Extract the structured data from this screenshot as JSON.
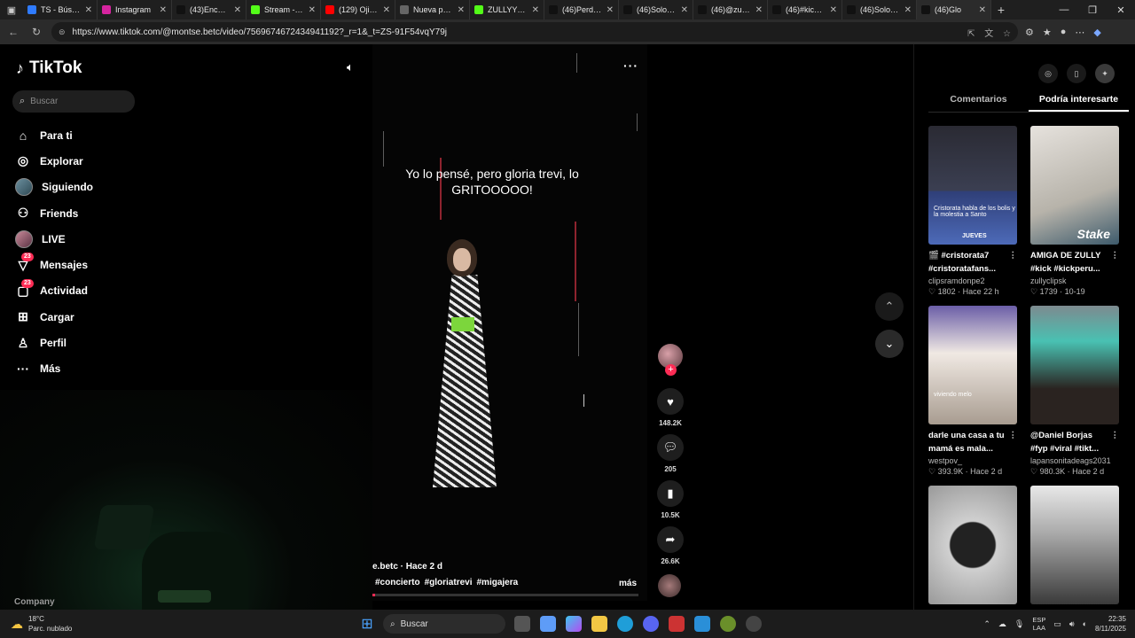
{
  "browser": {
    "tabs": [
      {
        "title": "TS - Búsqueda",
        "color": "#2f7bff"
      },
      {
        "title": "Instagram",
        "color": "#d6249f"
      },
      {
        "title": "(43)Encuentra",
        "color": "#111111"
      },
      {
        "title": "Stream - Kick",
        "color": "#53fc18"
      },
      {
        "title": "(129) Ojitos",
        "color": "#ff0000"
      },
      {
        "title": "Nueva pestaña",
        "color": "#666666"
      },
      {
        "title": "ZULLYY_CS",
        "color": "#53fc18"
      },
      {
        "title": "(46)Perdóname",
        "color": "#111111"
      },
      {
        "title": "(46)Solo reco",
        "color": "#111111"
      },
      {
        "title": "(46)@zullyy",
        "color": "#111111"
      },
      {
        "title": "(46)#kickpe",
        "color": "#111111"
      },
      {
        "title": "(46)Solo reco",
        "color": "#111111"
      },
      {
        "title": "(46)Glo",
        "color": "#111111"
      }
    ],
    "url": "https://www.tiktok.com/@montse.betc/video/7569674672434941192?_r=1&_t=ZS-91F54vqY79j"
  },
  "tiktok": {
    "logo": "TikTok",
    "search_placeholder": "Buscar",
    "nav": [
      {
        "label": "Para ti",
        "icon": "home-icon"
      },
      {
        "label": "Explorar",
        "icon": "compass-icon"
      },
      {
        "label": "Siguiendo",
        "icon": "following-avatar"
      },
      {
        "label": "Friends",
        "icon": "friends-icon"
      },
      {
        "label": "LIVE",
        "icon": "live-avatar"
      },
      {
        "label": "Mensajes",
        "icon": "messages-icon",
        "badge": "23"
      },
      {
        "label": "Actividad",
        "icon": "activity-icon",
        "badge": "23"
      },
      {
        "label": "Cargar",
        "icon": "upload-icon"
      },
      {
        "label": "Perfil",
        "icon": "profile-icon"
      },
      {
        "label": "Más",
        "icon": "more-icon"
      }
    ],
    "company": "Company"
  },
  "video": {
    "caption": "Yo lo pensé, pero gloria trevi, lo GRITOOOOO!",
    "meta": "e.betc · Hace 2 d",
    "tags": [
      "#concierto",
      "#gloriatrevi",
      "#migajera"
    ],
    "more": "más",
    "progress": 0.01,
    "likes": "148.2K",
    "comments": "205",
    "saves": "10.5K",
    "shares": "26.6K",
    "accent": "#fe2c55"
  },
  "sidebar": {
    "tabs": [
      "Comentarios",
      "Podría interesarte"
    ],
    "active_tab": 1,
    "cards": [
      {
        "title": "🎬 #cristorata7 #cristoratafans...",
        "author": "clipsramdonpe2",
        "stats": "♡ 1802 · Hace 22 h",
        "overlay": "Cristorata habla de los bolis y la molestia a Santo",
        "badge": "JUEVES"
      },
      {
        "title": "AMIGA DE ZULLY #kick #kickperu...",
        "author": "zullyclipsk",
        "stats": "♡ 1739 · 10-19",
        "badge": "Stake"
      },
      {
        "title": "darle una casa a tu mamá es mala...",
        "author": "westpov_",
        "stats": "♡ 393.9K · Hace 2 d",
        "overlay": "viviendo melo"
      },
      {
        "title": "@Daniel Borjas #fyp #viral #tikt...",
        "author": "lapansonitadeags2031",
        "stats": "♡ 980.3K · Hace 2 d"
      },
      {
        "title": "",
        "author": "",
        "stats": ""
      },
      {
        "title": "",
        "author": "",
        "stats": ""
      }
    ]
  },
  "taskbar": {
    "temp": "18°C",
    "weather": "Parc. nublado",
    "search": "Buscar",
    "lang_1": "ESP",
    "lang_2": "LAA",
    "time": "22:35",
    "date": "8/11/2025"
  }
}
